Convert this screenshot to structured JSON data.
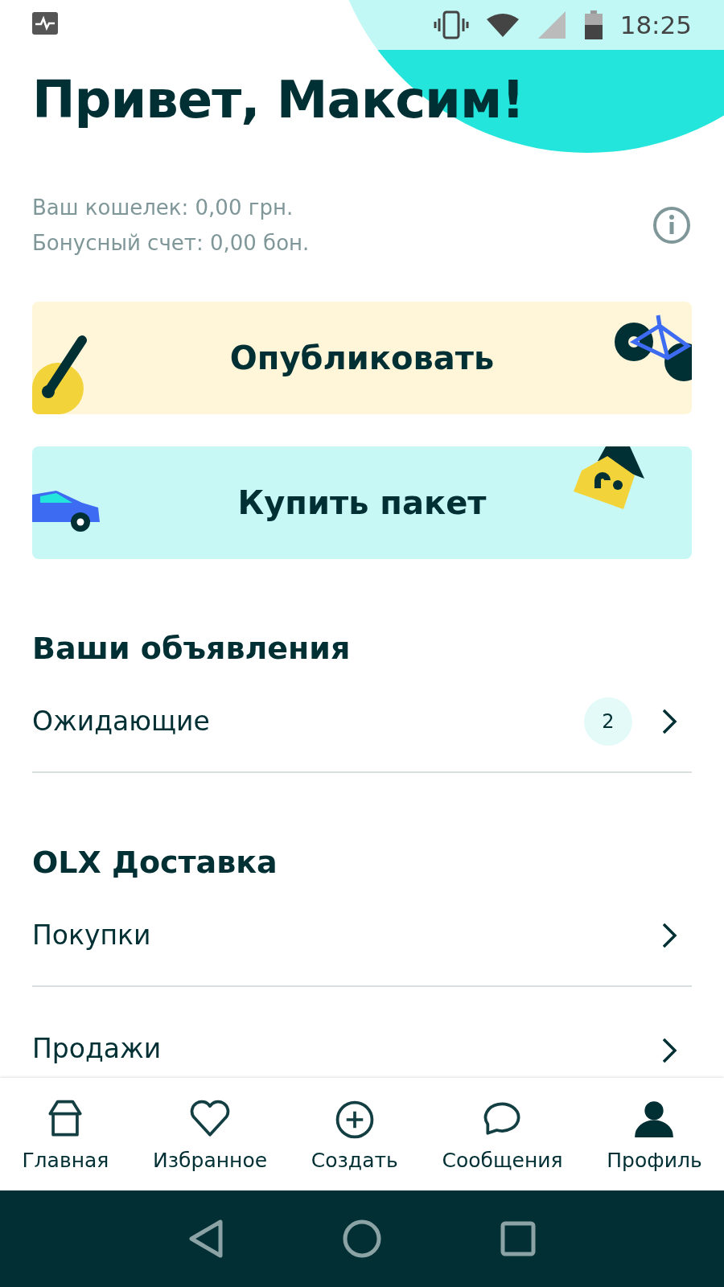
{
  "status_bar": {
    "time": "18:25"
  },
  "greeting": "Привет, Максим!",
  "wallet": [
    "Ваш кошелек: 0,00 грн.",
    "Бонусный счет: 0,00 бон."
  ],
  "actions": [
    {
      "label": "Опубликовать",
      "kind": "publish"
    },
    {
      "label": "Купить пакет",
      "kind": "package"
    }
  ],
  "sections": [
    {
      "title": "Ваши объявления",
      "items": [
        {
          "label": "Ожидающие",
          "badge": "2"
        }
      ]
    },
    {
      "title": "OLX Доставка",
      "items": [
        {
          "label": "Покупки"
        },
        {
          "label": "Продажи"
        }
      ]
    }
  ],
  "bottom_nav": [
    {
      "label": "Главная",
      "kind": "home",
      "selected": false
    },
    {
      "label": "Избранное",
      "kind": "heart",
      "selected": false
    },
    {
      "label": "Создать",
      "kind": "plus",
      "selected": false
    },
    {
      "label": "Сообщения",
      "kind": "chat",
      "selected": false
    },
    {
      "label": "Профиль",
      "kind": "person",
      "selected": true
    }
  ]
}
